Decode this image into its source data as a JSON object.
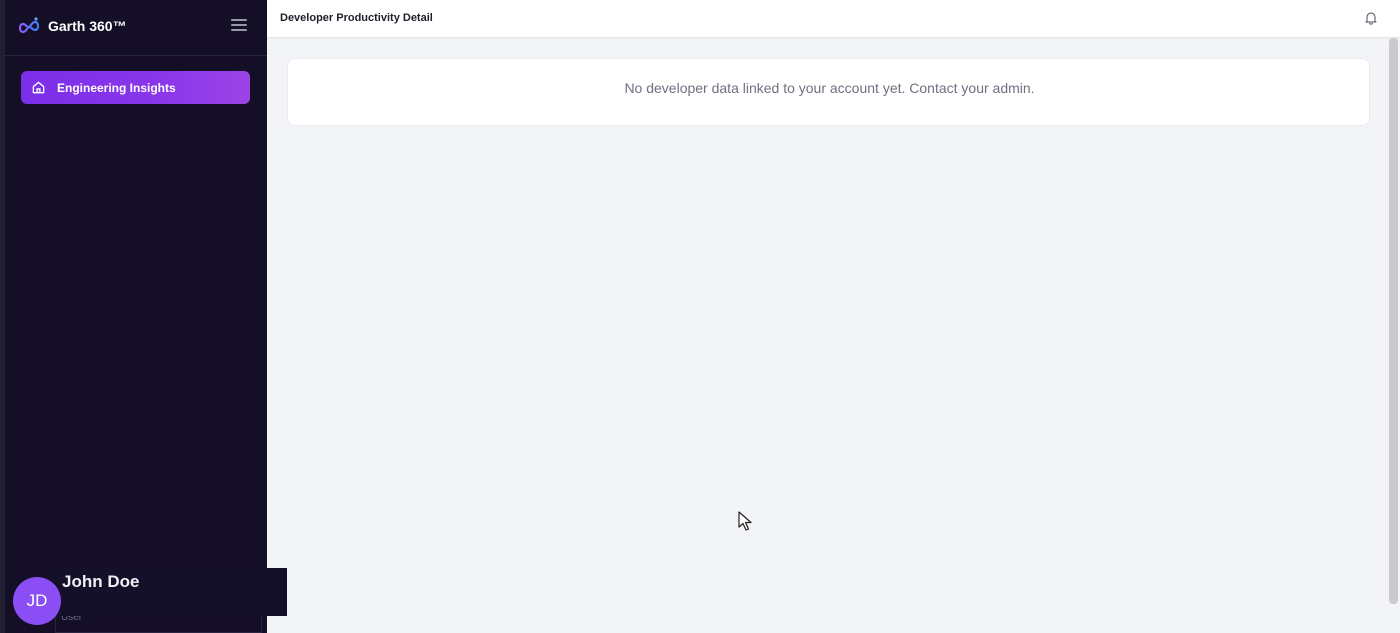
{
  "brand": {
    "name": "Garth 360™",
    "logo_icon": "infinity-logo-icon"
  },
  "sidebar": {
    "menu_icon": "hamburger-icon",
    "items": [
      {
        "label": "Engineering Insights",
        "icon": "home-icon",
        "active": true
      }
    ]
  },
  "header": {
    "title": "Developer Productivity Detail",
    "bell_icon": "bell-icon"
  },
  "main": {
    "empty_message": "No developer data linked to your account yet. Contact your admin."
  },
  "user": {
    "initials": "JD",
    "name": "John Doe",
    "role": "User"
  },
  "colors": {
    "sidebar_bg": "#140f26",
    "accent": "#8a36ea",
    "avatar": "#8a4ef4",
    "page_bg": "#f3f4f8"
  }
}
